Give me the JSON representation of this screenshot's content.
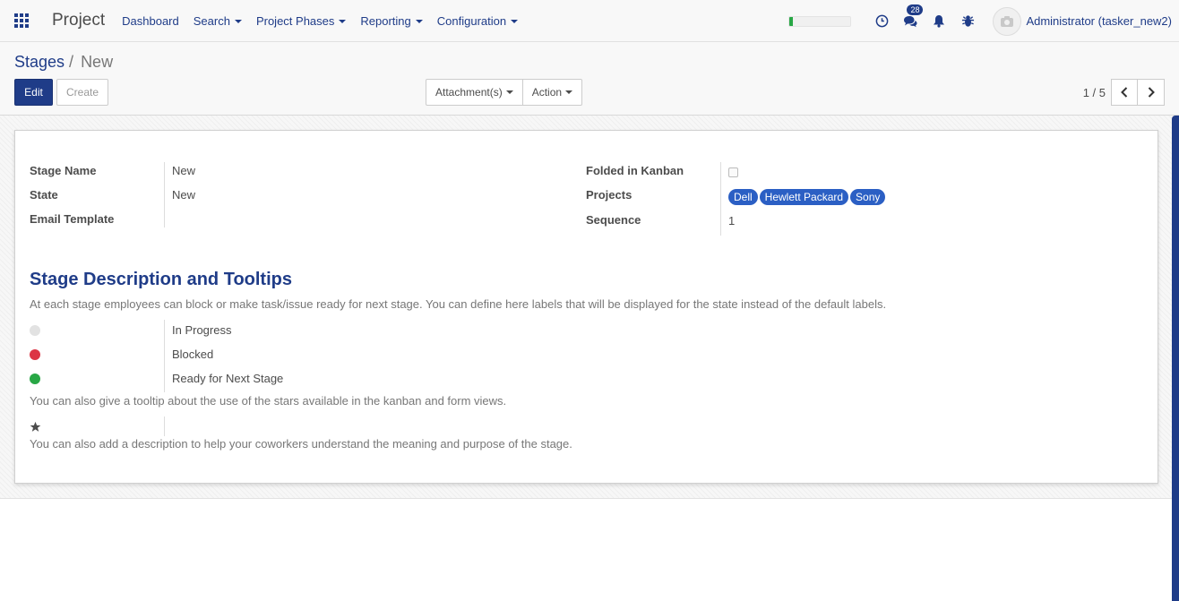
{
  "navbar": {
    "brand": "Project",
    "menu": [
      {
        "label": "Dashboard",
        "dropdown": false
      },
      {
        "label": "Search",
        "dropdown": true
      },
      {
        "label": "Project Phases",
        "dropdown": true
      },
      {
        "label": "Reporting",
        "dropdown": true
      },
      {
        "label": "Configuration",
        "dropdown": true
      }
    ],
    "progress_fraction": 0.05,
    "progress_color": "#28a745",
    "messages_count": "28",
    "user": "Administrator (tasker_new2)",
    "icons": [
      "apps-icon",
      "clock-icon",
      "chat-icon",
      "bell-icon",
      "bug-icon",
      "camera-icon"
    ]
  },
  "control_panel": {
    "breadcrumb_parent": "Stages",
    "breadcrumb_sep": "/",
    "breadcrumb_current": "New",
    "edit_label": "Edit",
    "create_label": "Create",
    "attachments_label": "Attachment(s)",
    "action_label": "Action",
    "pager": "1 / 5"
  },
  "form": {
    "left_fields": [
      {
        "label": "Stage Name",
        "value": "New"
      },
      {
        "label": "State",
        "value": "New"
      },
      {
        "label": "Email Template",
        "value": ""
      }
    ],
    "right_fields": {
      "folded_label": "Folded in Kanban",
      "folded_value": false,
      "projects_label": "Projects",
      "projects": [
        "Dell",
        "Hewlett Packard",
        "Sony"
      ],
      "sequence_label": "Sequence",
      "sequence_value": "1"
    },
    "section_title": "Stage Description and Tooltips",
    "section_help": "At each stage employees can block or make task/issue ready for next stage. You can define here labels that will be displayed for the state instead of the default labels.",
    "states": [
      {
        "color": "#e2e2e2",
        "label": "In Progress"
      },
      {
        "color": "#dc3545",
        "label": "Blocked"
      },
      {
        "color": "#28a745",
        "label": "Ready for Next Stage"
      }
    ],
    "stars_help": "You can also give a tooltip about the use of the stars available in the kanban and form views.",
    "description_help": "You can also add a description to help your coworkers understand the meaning and purpose of the stage."
  },
  "colors": {
    "accent": "#1f3c88",
    "tag": "#2b5fc4"
  }
}
